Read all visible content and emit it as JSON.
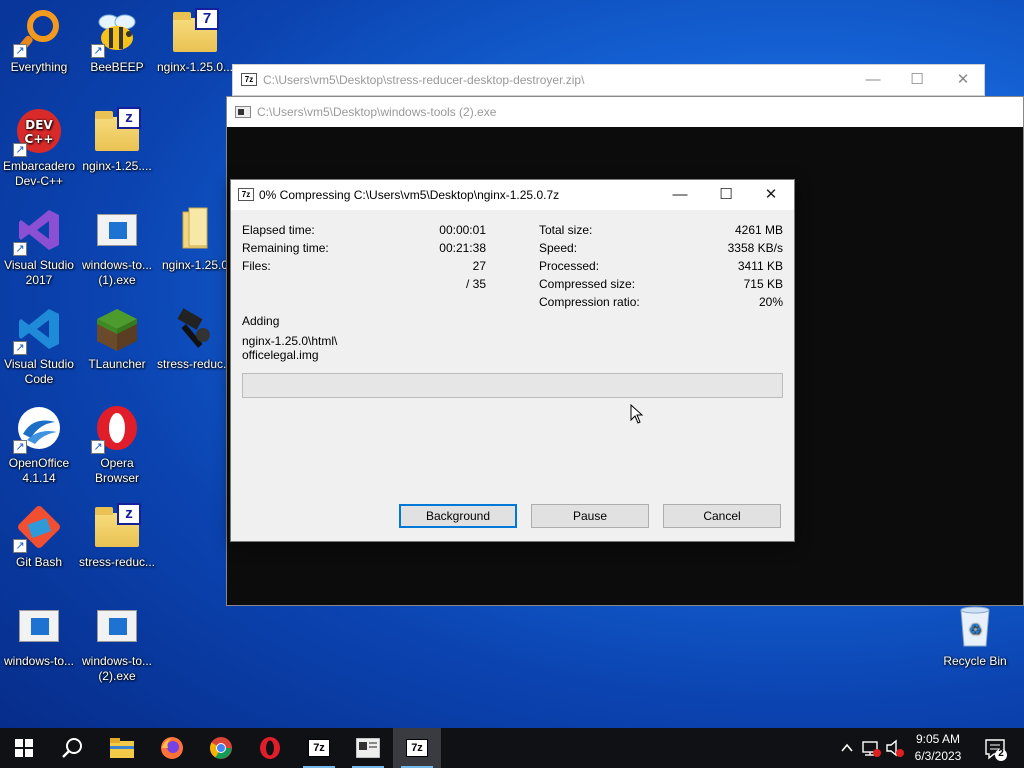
{
  "desktop": {
    "icons": [
      {
        "label": "Everything",
        "icon": "everything-search-icon"
      },
      {
        "label": "BeeBEEP",
        "icon": "bee-icon"
      },
      {
        "label": "nginx-1.25.0...",
        "icon": "7z-archive-folder-icon"
      },
      {
        "label": "Embarcadero Dev-C++",
        "icon": "devcpp-icon"
      },
      {
        "label": "nginx-1.25....",
        "icon": "zip-folder-icon"
      },
      {
        "label": "Visual Studio 2017",
        "icon": "visual-studio-icon"
      },
      {
        "label": "windows-to... (1).exe",
        "icon": "exe-window-icon"
      },
      {
        "label": "nginx-1.25.0",
        "icon": "folder-icon"
      },
      {
        "label": "Visual Studio Code",
        "icon": "vscode-icon"
      },
      {
        "label": "TLauncher",
        "icon": "minecraft-block-icon"
      },
      {
        "label": "stress-reduc...",
        "icon": "hammer-icon"
      },
      {
        "label": "OpenOffice 4.1.14",
        "icon": "openoffice-icon"
      },
      {
        "label": "Opera Browser",
        "icon": "opera-icon"
      },
      {
        "label": "Git Bash",
        "icon": "git-icon"
      },
      {
        "label": "stress-reduc...",
        "icon": "zip-folder-icon"
      },
      {
        "label": "windows-to...",
        "icon": "exe-window-icon"
      },
      {
        "label": "windows-to... (2).exe",
        "icon": "exe-window-icon"
      },
      {
        "label": "Recycle Bin",
        "icon": "recycle-bin-icon"
      }
    ]
  },
  "back_window": {
    "title": "C:\\Users\\vm5\\Desktop\\stress-reducer-desktop-destroyer.zip\\"
  },
  "console_window": {
    "title": "C:\\Users\\vm5\\Desktop\\windows-tools (2).exe"
  },
  "dialog": {
    "title": "0% Compressing C:\\Users\\vm5\\Desktop\\nginx-1.25.0.7z",
    "left_fields": [
      {
        "label": "Elapsed time:",
        "value": "00:00:01"
      },
      {
        "label": "Remaining time:",
        "value": "00:21:38"
      },
      {
        "label": "Files:",
        "value": "27"
      },
      {
        "label": "",
        "value": "/ 35"
      }
    ],
    "right_fields": [
      {
        "label": "Total size:",
        "value": "4261 MB"
      },
      {
        "label": "Speed:",
        "value": "3358 KB/s"
      },
      {
        "label": "Processed:",
        "value": "3411 KB"
      },
      {
        "label": "Compressed size:",
        "value": "715 KB"
      },
      {
        "label": "Compression ratio:",
        "value": "20%"
      }
    ],
    "action_label": "Adding",
    "current_file_line1": "nginx-1.25.0\\html\\",
    "current_file_line2": "officelegal.img",
    "progress_percent": 0,
    "buttons": {
      "background": "Background",
      "pause": "Pause",
      "cancel": "Cancel"
    }
  },
  "taskbar": {
    "pinned": [
      "start-icon",
      "search-icon",
      "file-explorer-icon",
      "firefox-icon",
      "chrome-icon",
      "opera-icon",
      "7zip-icon",
      "console-app-icon",
      "7zip-active-icon"
    ],
    "clock_time": "9:05 AM",
    "clock_date": "6/3/2023",
    "notification_count": "2"
  },
  "colors": {
    "accent": "#0078d7",
    "progress": "#06b025",
    "taskbar": "#101114"
  }
}
